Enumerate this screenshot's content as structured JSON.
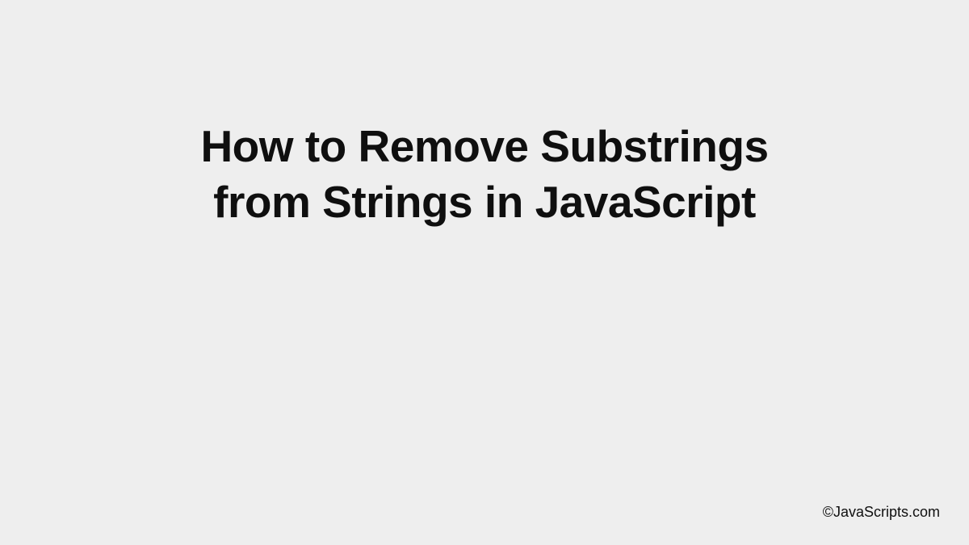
{
  "title": {
    "line1": "How to Remove Substrings",
    "line2": "from Strings in JavaScript"
  },
  "attribution": "©JavaScripts.com"
}
